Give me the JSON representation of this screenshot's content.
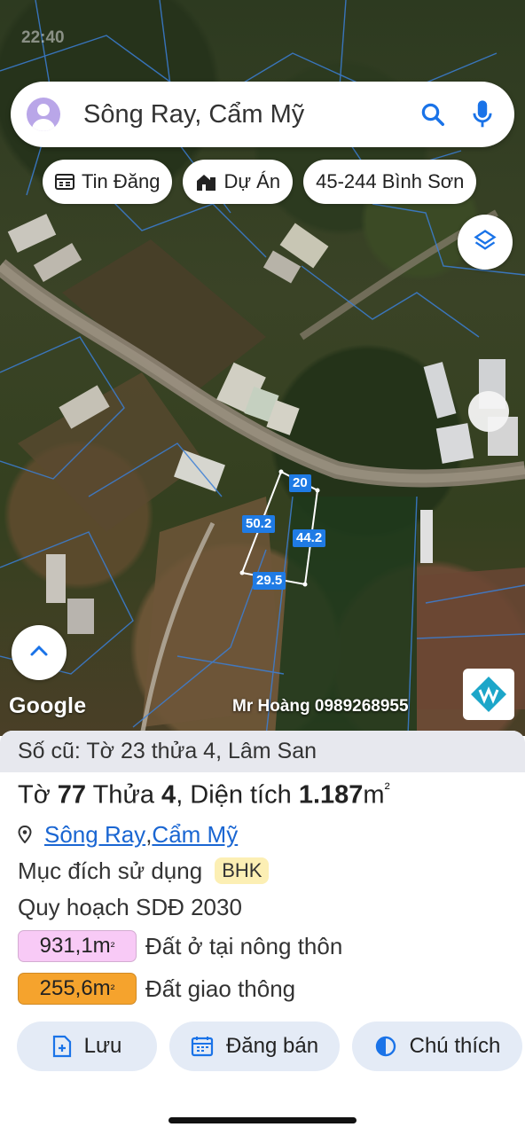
{
  "status_bar": {
    "time": "22:40",
    "right": ""
  },
  "search": {
    "text": "Sông Ray, Cẩm Mỹ"
  },
  "chips": [
    {
      "label": "Tin Đăng",
      "icon": "listing-icon"
    },
    {
      "label": "Dự Án",
      "icon": "project-building-icon"
    },
    {
      "label": "45-244 Bình Sơn",
      "icon": ""
    }
  ],
  "map": {
    "dimensions": {
      "top": "20",
      "left": "50.2",
      "right": "44.2",
      "bottom": "29.5"
    },
    "google_label": "Google",
    "watermark": "Mr Hoàng 0989268955"
  },
  "sheet": {
    "old_ref": "Số cũ: Tờ 23 thửa 4, Lâm San",
    "parcel_prefix": "Tờ ",
    "sheet_no": "77",
    "thua_label": " Thửa ",
    "thua_no": "4",
    "area_label": ", Diện tích ",
    "area_value": "1.187",
    "area_unit": "m",
    "area_sup": "²",
    "location": {
      "commune": "Sông Ray",
      "district": "Cẩm Mỹ",
      "separator": ", "
    },
    "purpose_label": "Mục đích sử dụng",
    "purpose_code": "BHK",
    "plan_label": "Quy hoạch SDĐ 2030",
    "land_uses": [
      {
        "area": "931,1m",
        "sup": "²",
        "label": "Đất ở tại nông thôn",
        "color": "#f8caf6"
      },
      {
        "area": "255,6m",
        "sup": "²",
        "label": "Đất giao thông",
        "color": "#f5a32d"
      }
    ],
    "actions": [
      {
        "label": "Lưu",
        "icon": "save-add-icon"
      },
      {
        "label": "Đăng bán",
        "icon": "calendar-icon"
      },
      {
        "label": "Chú thích",
        "icon": "legend-contrast-icon"
      }
    ]
  }
}
